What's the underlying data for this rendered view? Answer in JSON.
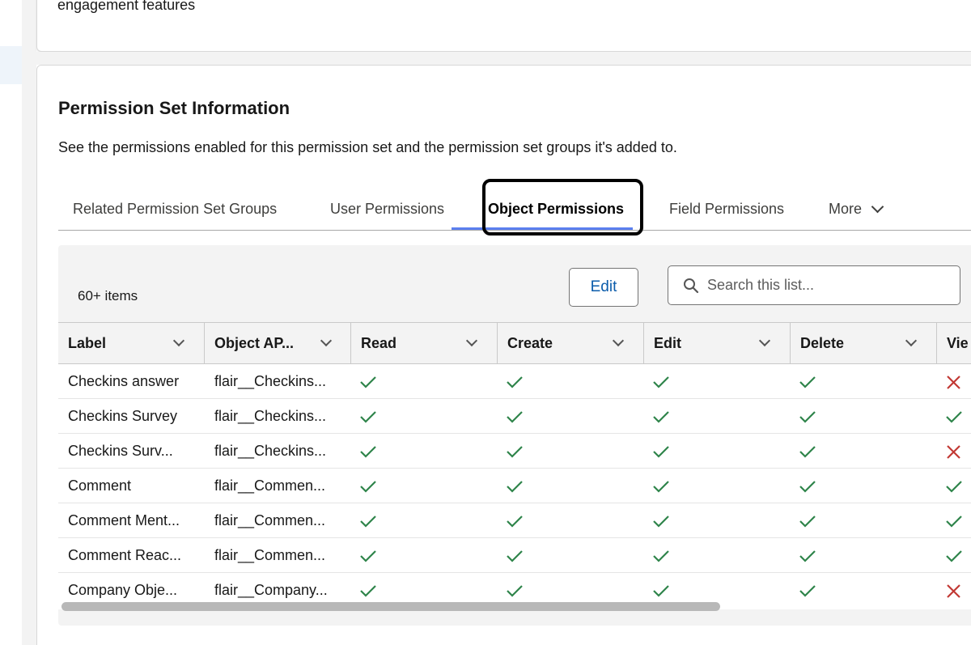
{
  "top_card": {
    "partial_text": "engagement features"
  },
  "permission_set": {
    "title": "Permission Set Information",
    "description": "See the permissions enabled for this permission set and the permission set groups it's added to."
  },
  "tabs": [
    {
      "label": "Related Permission Set Groups"
    },
    {
      "label": "User Permissions"
    },
    {
      "label": "Object Permissions",
      "active": true
    },
    {
      "label": "Field Permissions"
    },
    {
      "label": "More"
    }
  ],
  "list": {
    "count_label": "60+ items",
    "edit_label": "Edit",
    "search_placeholder": "Search this list...",
    "columns": [
      "Label",
      "Object AP...",
      "Read",
      "Create",
      "Edit",
      "Delete",
      "Vie"
    ],
    "rows": [
      {
        "label": "Checkins answer",
        "api": "flair__Checkins...",
        "perms": [
          true,
          true,
          true,
          true,
          false
        ]
      },
      {
        "label": "Checkins Survey",
        "api": "flair__Checkins...",
        "perms": [
          true,
          true,
          true,
          true,
          true
        ]
      },
      {
        "label": "Checkins Surv...",
        "api": "flair__Checkins...",
        "perms": [
          true,
          true,
          true,
          true,
          false
        ]
      },
      {
        "label": "Comment",
        "api": "flair__Commen...",
        "perms": [
          true,
          true,
          true,
          true,
          true
        ]
      },
      {
        "label": "Comment Ment...",
        "api": "flair__Commen...",
        "perms": [
          true,
          true,
          true,
          true,
          true
        ]
      },
      {
        "label": "Comment Reac...",
        "api": "flair__Commen...",
        "perms": [
          true,
          true,
          true,
          true,
          true
        ]
      },
      {
        "label": "Company Obje...",
        "api": "flair__Company...",
        "perms": [
          true,
          true,
          true,
          true,
          false
        ]
      }
    ]
  },
  "colors": {
    "check": "#2e844a",
    "cross": "#c23934",
    "brand_blue": "#0b5cab",
    "active_tab": "#5b7fef"
  },
  "icons": {
    "check": "check-icon",
    "cross": "cross-icon",
    "search": "search-icon",
    "chevron": "chevron-down-icon"
  }
}
